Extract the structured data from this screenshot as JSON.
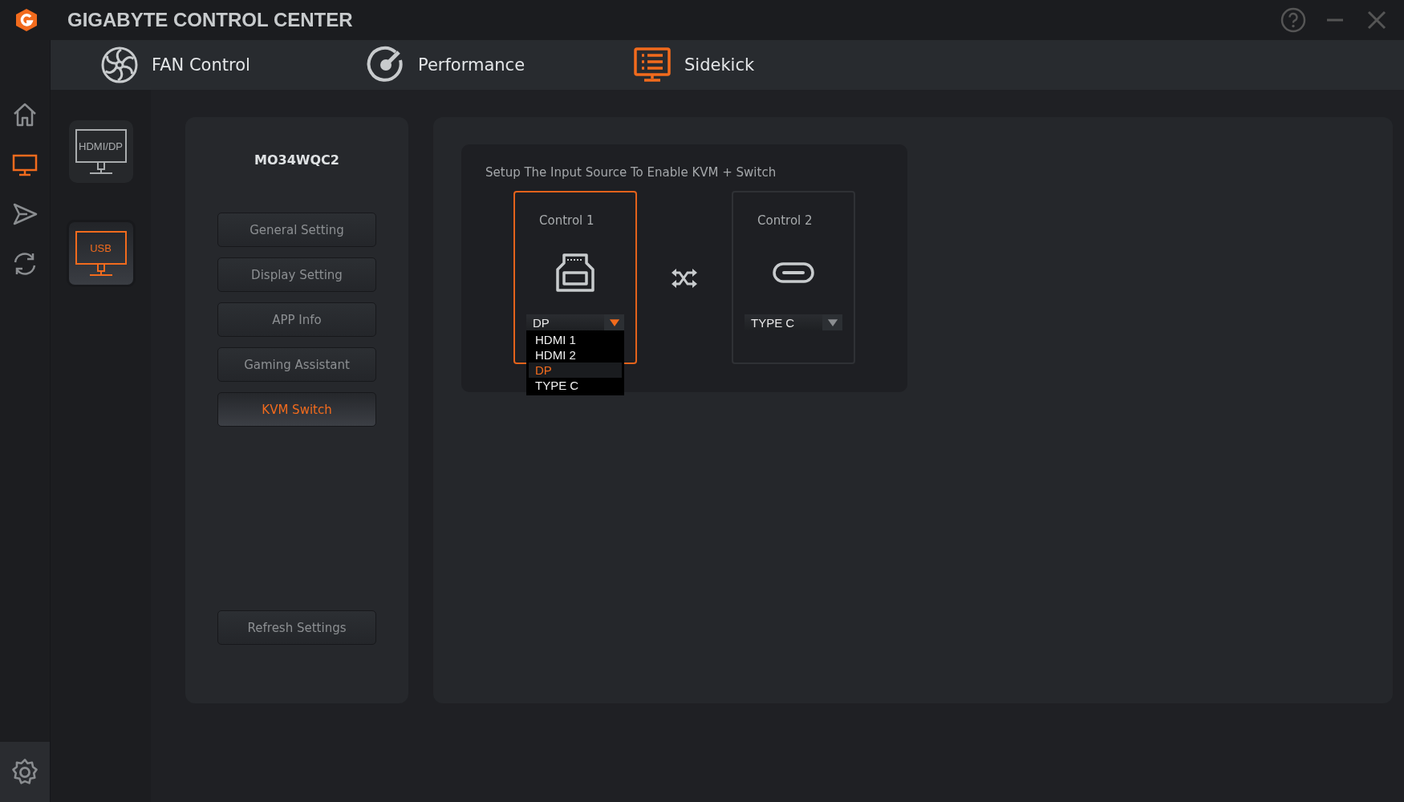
{
  "window": {
    "title": "GIGABYTE CONTROL CENTER"
  },
  "top_tabs": [
    {
      "kind": "fan",
      "label": "FAN Control",
      "selected": false
    },
    {
      "kind": "gauge",
      "label": "Performance",
      "selected": false
    },
    {
      "kind": "sidekick",
      "label": "Sidekick",
      "selected": true
    }
  ],
  "rail": [
    {
      "kind": "home",
      "selected": false
    },
    {
      "kind": "monitor",
      "selected": true
    },
    {
      "kind": "send",
      "selected": false
    },
    {
      "kind": "sync",
      "selected": false
    }
  ],
  "devices": [
    {
      "label": "HDMI/DP",
      "selected": false
    },
    {
      "label": "USB",
      "selected": true
    }
  ],
  "model": "MO34WQC2",
  "menu": [
    {
      "label": "General Setting",
      "selected": false
    },
    {
      "label": "Display Setting",
      "selected": false
    },
    {
      "label": "APP Info",
      "selected": false
    },
    {
      "label": "Gaming Assistant",
      "selected": false
    },
    {
      "label": "KVM Switch",
      "selected": true
    }
  ],
  "refresh_button": "Refresh Settings",
  "kvm": {
    "instruction": "Setup The Input Source To Enable KVM + Switch",
    "controls": [
      {
        "title": "Control 1",
        "kind": "usbb",
        "selected": true,
        "value": "DP",
        "expanded": true,
        "options": [
          {
            "label": "HDMI 1",
            "selected": false
          },
          {
            "label": "HDMI 2",
            "selected": false
          },
          {
            "label": "DP",
            "selected": true
          },
          {
            "label": "TYPE C",
            "selected": false
          }
        ]
      },
      {
        "title": "Control 2",
        "kind": "usbc",
        "selected": false,
        "value": "TYPE C",
        "expanded": false
      }
    ]
  }
}
